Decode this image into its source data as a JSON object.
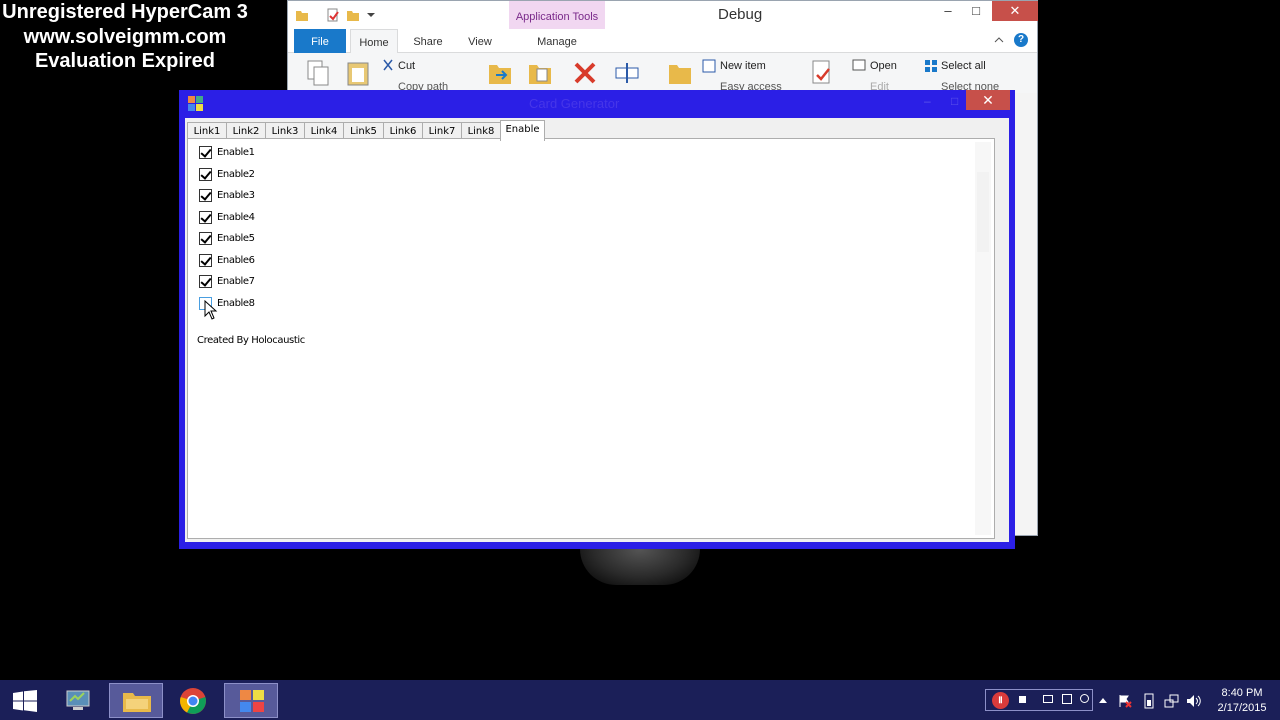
{
  "watermark": {
    "line1": "Unregistered HyperCam 3",
    "line2": "www.solveigmm.com",
    "line3": "Evaluation Expired"
  },
  "explorer": {
    "title": "Debug",
    "context_group": "Application Tools",
    "tabs": [
      "File",
      "Home",
      "Share",
      "View",
      "Manage"
    ],
    "ribbon": {
      "cut": "Cut",
      "copy_path": "Copy path",
      "new_item": "New item",
      "easy_access": "Easy access",
      "open": "Open",
      "edit": "Edit",
      "select_all": "Select all",
      "select_none": "Select none"
    },
    "controls": {
      "minimize": "–",
      "maximize": "□",
      "close": "✕",
      "help": "?"
    }
  },
  "cardgen": {
    "title": "Card Generator",
    "controls": {
      "minimize": "–",
      "maximize": "□",
      "close": "✕"
    },
    "tabs": [
      {
        "label": "Link1"
      },
      {
        "label": "Link2"
      },
      {
        "label": "Link3"
      },
      {
        "label": "Link4"
      },
      {
        "label": "Link5"
      },
      {
        "label": "Link6"
      },
      {
        "label": "Link7"
      },
      {
        "label": "Link8"
      },
      {
        "label": "Enable"
      }
    ],
    "active_tab": "Enable",
    "checkboxes": [
      {
        "label": "Enable1",
        "checked": true
      },
      {
        "label": "Enable2",
        "checked": true
      },
      {
        "label": "Enable3",
        "checked": true
      },
      {
        "label": "Enable4",
        "checked": true
      },
      {
        "label": "Enable5",
        "checked": true
      },
      {
        "label": "Enable6",
        "checked": true
      },
      {
        "label": "Enable7",
        "checked": true
      },
      {
        "label": "Enable8",
        "checked": false
      }
    ],
    "credit": "Created By Holocaustic"
  },
  "taskbar": {
    "apps": [
      "start-button",
      "computer-icon",
      "file-explorer-icon",
      "chrome-icon",
      "card-generator-icon"
    ],
    "tray": {
      "record": "Ⅱ"
    },
    "clock": {
      "time": "8:40 PM",
      "date": "2/17/2015"
    }
  },
  "colors": {
    "cardgen_frame": "#2b1fe6",
    "taskbar": "#1b1f58",
    "accent_blue": "#1979ca",
    "close_red": "#c7504a"
  }
}
